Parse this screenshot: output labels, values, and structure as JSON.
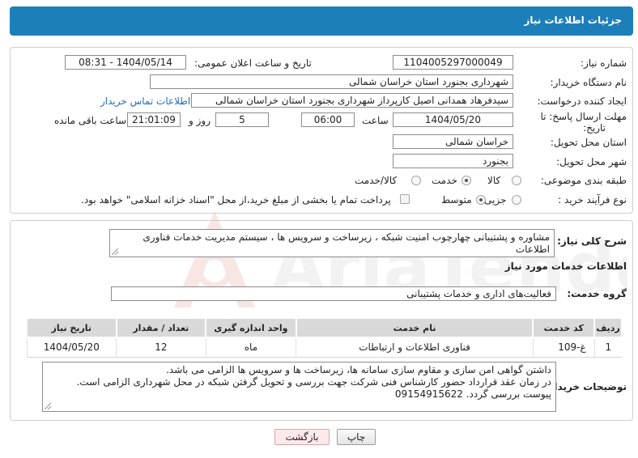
{
  "header": {
    "title": "جزئیات اطلاعات نیاز"
  },
  "form": {
    "need_number": {
      "label": "شماره نیاز:",
      "value": "1104005297000049"
    },
    "announce_datetime": {
      "label": "تاریخ و ساعت اعلان عمومی:",
      "value": "1404/05/14 - 08:31"
    },
    "buyer_org": {
      "label": "نام دستگاه خریدار:",
      "value": "شهرداری بجنورد استان خراسان شمالی"
    },
    "requester": {
      "label": "ایجاد کننده درخواست:",
      "value": "سیدفرهاد همدانی اصیل کارپرداز شهرداری بجنورد استان خراسان شمالی",
      "contact_link": "اطلاعات تماس خریدار"
    },
    "deadline": {
      "label_line1": "مهلت ارسال پاسخ: تا",
      "label_line2": "تاریخ:",
      "date": "1404/05/20",
      "time_label": "ساعت",
      "time": "06:00",
      "days": "5",
      "days_label": "روز و",
      "remaining": "21:01:09",
      "remaining_label": "ساعت باقی مانده"
    },
    "delivery_province": {
      "label": "استان محل تحویل:",
      "value": "خراسان شمالی"
    },
    "delivery_city": {
      "label": "شهر محل تحویل:",
      "value": "بجنورد"
    },
    "category": {
      "label": "طبقه بندی موضوعی:",
      "options": [
        "کالا",
        "خدمت",
        "کالا/خدمت"
      ],
      "selected": "خدمت"
    },
    "process_type": {
      "label": "نوع فرآیند خرید :",
      "options": [
        "جزیی",
        "متوسط"
      ],
      "selected": "متوسط",
      "payment_note": "پرداخت تمام یا بخشی از مبلغ خرید،از محل \"اسناد خزانه اسلامی\" خواهد بود."
    }
  },
  "summary": {
    "label": "شرح کلی نیاز:",
    "text": "مشاوره و پشتیبانی چهارچوب امنیت شبکه ، زیرساخت و سرویس ها ، سیستم مدیریت خدمات فناوری اطلاعات"
  },
  "services": {
    "section_title": "اطلاعات خدمات مورد نیاز",
    "group_label": "گروه خدمت:",
    "group_value": "فعالیت‌های اداری و خدمات پشتیبانی",
    "columns": [
      "ردیف",
      "کد خدمت",
      "نام خدمت",
      "واحد اندازه گیری",
      "تعداد / مقدار",
      "تاریخ نیاز"
    ],
    "rows": [
      {
        "row": "1",
        "code": "غ-109",
        "name": "فناوری اطلاعات و ارتباطات",
        "unit": "ماه",
        "qty": "12",
        "date": "1404/05/20"
      }
    ]
  },
  "buyer_notes": {
    "label": "توضیحات خریدار:",
    "lines": [
      "داشتن گواهی امن سازی و مقاوم سازی سامانه ها، زیرساخت ها و سرویس ها الزامی می باشد.",
      "در زمان عقد قرارداد حضور کارشناس فنی شرکت جهت بررسی و تحویل گرفتن شبکه در محل شهرداری الزامی است.",
      "پیوست بررسی گردد. 09154915622"
    ]
  },
  "buttons": {
    "print": "چاپ",
    "back": "بازگشت"
  },
  "watermark": {
    "text": "AriaTender.neT"
  }
}
